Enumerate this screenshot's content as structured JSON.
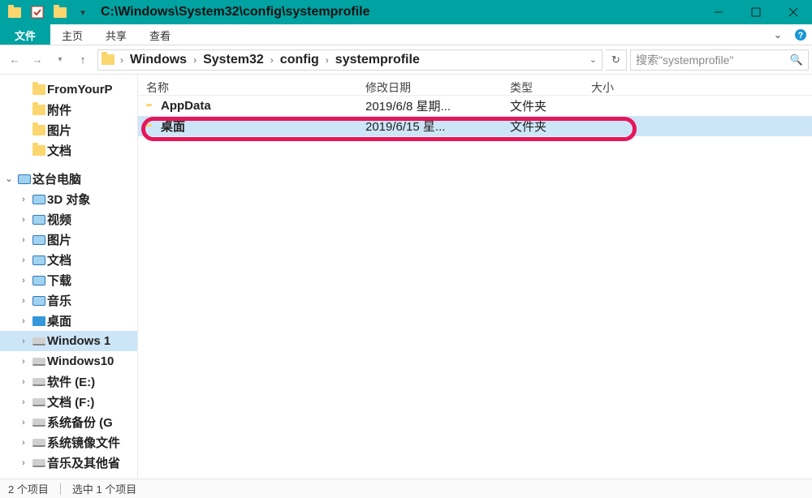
{
  "title": "C:\\Windows\\System32\\config\\systemprofile",
  "ribbon": {
    "file": "文件",
    "tabs": [
      "主页",
      "共享",
      "查看"
    ]
  },
  "breadcrumb": [
    "Windows",
    "System32",
    "config",
    "systemprofile"
  ],
  "search_placeholder": "搜索\"systemprofile\"",
  "columns": {
    "name": "名称",
    "date": "修改日期",
    "type": "类型",
    "size": "大小"
  },
  "rows": [
    {
      "name": "AppData",
      "date": "2019/6/8 星期...",
      "type": "文件夹",
      "selected": false
    },
    {
      "name": "桌面",
      "date": "2019/6/15 星...",
      "type": "文件夹",
      "selected": true
    }
  ],
  "nav_quick": [
    {
      "label": "FromYourP",
      "icon": "folder"
    },
    {
      "label": "附件",
      "icon": "folder"
    },
    {
      "label": "图片",
      "icon": "folder"
    },
    {
      "label": "文档",
      "icon": "folder"
    }
  ],
  "nav_pc_label": "这台电脑",
  "nav_pc": [
    {
      "label": "3D 对象",
      "icon": "pc"
    },
    {
      "label": "视频",
      "icon": "pc"
    },
    {
      "label": "图片",
      "icon": "pc"
    },
    {
      "label": "文档",
      "icon": "pc"
    },
    {
      "label": "下载",
      "icon": "pc"
    },
    {
      "label": "音乐",
      "icon": "pc"
    },
    {
      "label": "桌面",
      "icon": "blue"
    },
    {
      "label": "Windows 1",
      "icon": "drive",
      "selected": true
    },
    {
      "label": "Windows10",
      "icon": "drive"
    },
    {
      "label": "软件 (E:)",
      "icon": "drive"
    },
    {
      "label": "文档 (F:)",
      "icon": "drive"
    },
    {
      "label": "系统备份 (G",
      "icon": "drive"
    },
    {
      "label": "系统镜像文件",
      "icon": "drive"
    },
    {
      "label": "音乐及其他省",
      "icon": "drive"
    }
  ],
  "status": {
    "count": "2 个项目",
    "selection": "选中 1 个项目"
  }
}
